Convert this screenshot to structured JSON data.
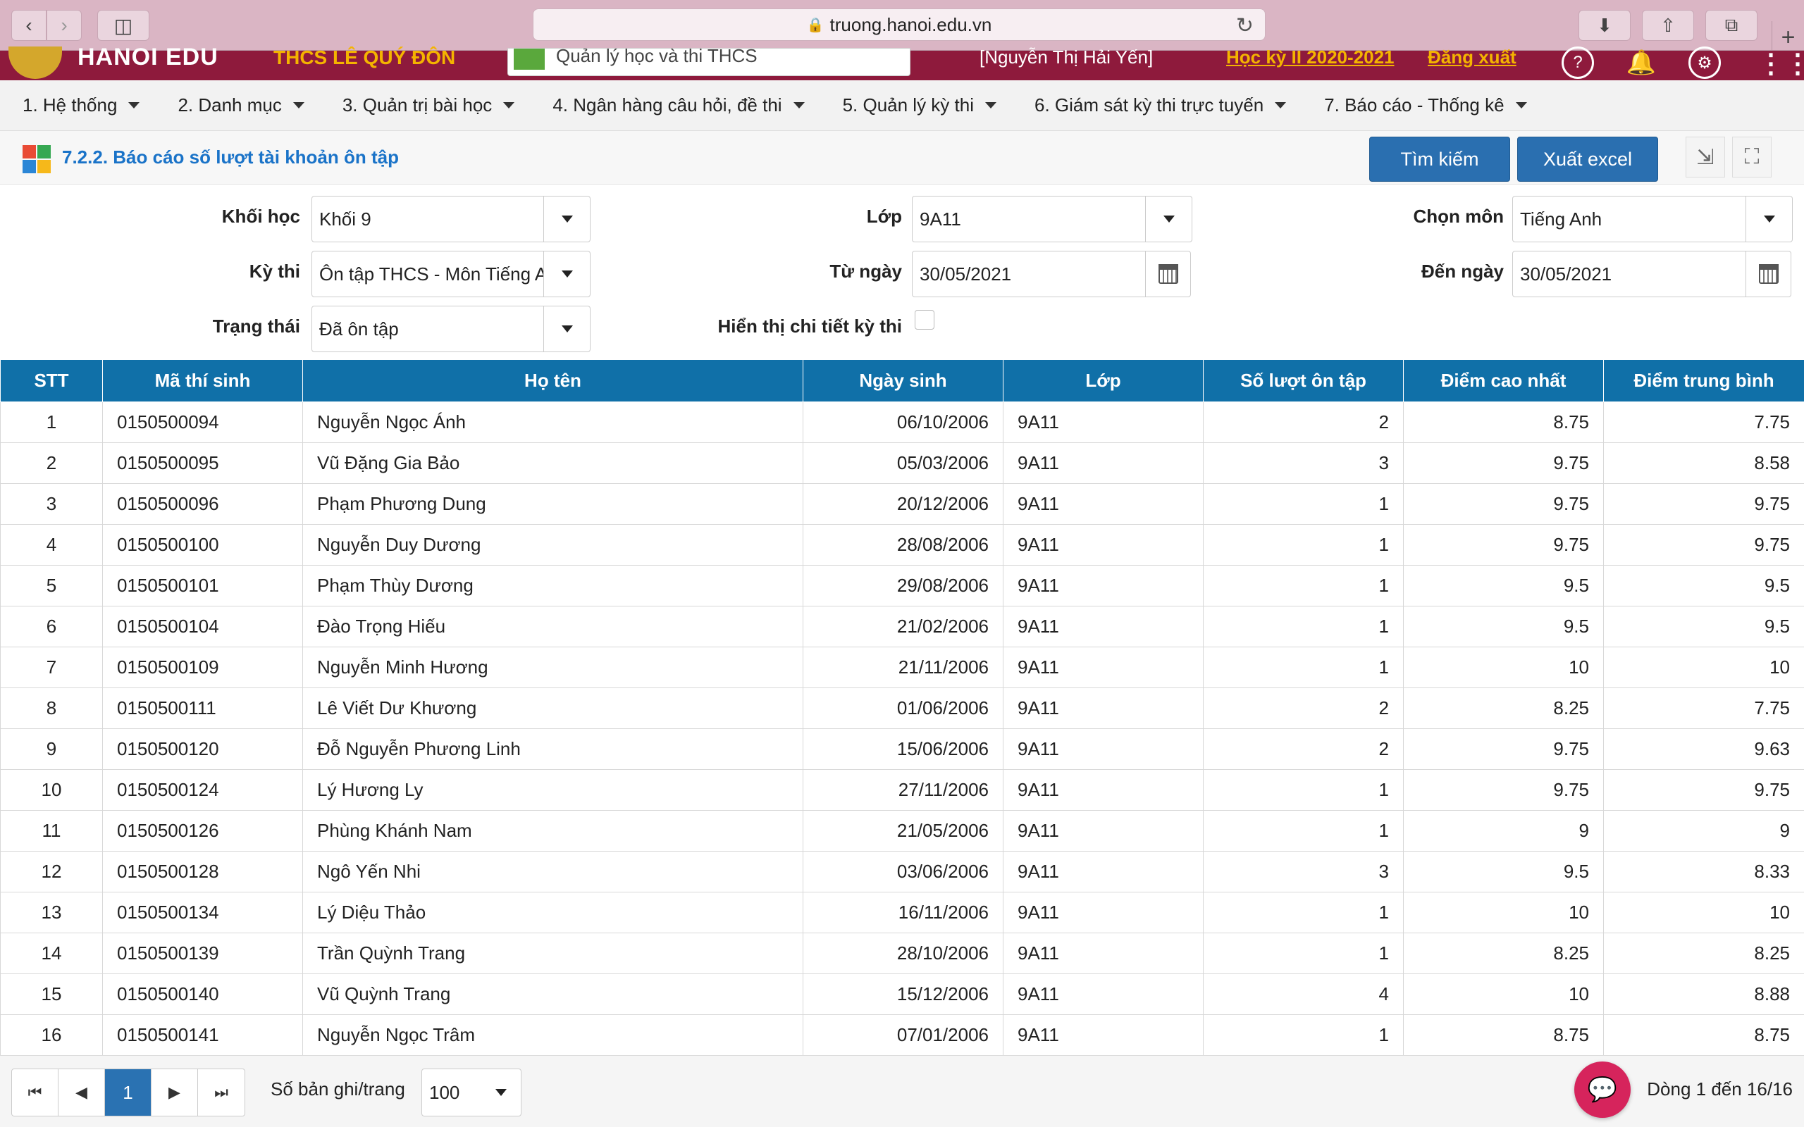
{
  "browser": {
    "url": "truong.hanoi.edu.vn"
  },
  "site": {
    "brand": "HANOI EDU",
    "school": "THCS LÊ QUÝ ĐÔN",
    "module": "Quản lý học và thi THCS",
    "user": "[Nguyễn Thị Hải Yến]",
    "year": "Học kỳ II 2020-2021",
    "logout": "Đăng xuất"
  },
  "menu": [
    "1. Hệ thống",
    "2. Danh mục",
    "3. Quản trị bài học",
    "4. Ngân hàng câu hỏi, đề thi",
    "5. Quản lý kỳ thi",
    "6. Giám sát kỳ thi trực tuyến",
    "7. Báo cáo - Thống kê"
  ],
  "page": {
    "title": "7.2.2. Báo cáo số lượt tài khoản ôn tập",
    "search_label": "Tìm kiếm",
    "excel_label": "Xuất excel",
    "logo_colors": [
      "#e94b35",
      "#36a852",
      "#2b86d6",
      "#f6b81a"
    ]
  },
  "filters": {
    "khoi_label": "Khối học",
    "khoi_value": "Khối 9",
    "lop_label": "Lớp",
    "lop_value": "9A11",
    "mon_label": "Chọn môn",
    "mon_value": "Tiếng Anh",
    "kythi_label": "Kỳ thi",
    "kythi_value": "Ôn tập THCS - Môn Tiếng Anh",
    "tungay_label": "Từ ngày",
    "tungay_value": "30/05/2021",
    "denngay_label": "Đến ngày",
    "denngay_value": "30/05/2021",
    "trangthai_label": "Trạng thái",
    "trangthai_value": "Đã ôn tập",
    "chitiet_label": "Hiển thị chi tiết kỳ thi"
  },
  "table": {
    "headers": [
      "STT",
      "Mã thí sinh",
      "Họ tên",
      "Ngày sinh",
      "Lớp",
      "Số lượt ôn tập",
      "Điểm cao nhất",
      "Điểm trung bình"
    ],
    "rows": [
      [
        "1",
        "0150500094",
        "Nguyễn Ngọc Ánh",
        "06/10/2006",
        "9A11",
        "2",
        "8.75",
        "7.75"
      ],
      [
        "2",
        "0150500095",
        "Vũ Đặng Gia Bảo",
        "05/03/2006",
        "9A11",
        "3",
        "9.75",
        "8.58"
      ],
      [
        "3",
        "0150500096",
        "Phạm Phương Dung",
        "20/12/2006",
        "9A11",
        "1",
        "9.75",
        "9.75"
      ],
      [
        "4",
        "0150500100",
        "Nguyễn Duy Dương",
        "28/08/2006",
        "9A11",
        "1",
        "9.75",
        "9.75"
      ],
      [
        "5",
        "0150500101",
        "Phạm Thùy Dương",
        "29/08/2006",
        "9A11",
        "1",
        "9.5",
        "9.5"
      ],
      [
        "6",
        "0150500104",
        "Đào Trọng Hiếu",
        "21/02/2006",
        "9A11",
        "1",
        "9.5",
        "9.5"
      ],
      [
        "7",
        "0150500109",
        "Nguyễn Minh Hương",
        "21/11/2006",
        "9A11",
        "1",
        "10",
        "10"
      ],
      [
        "8",
        "0150500111",
        "Lê Viết Dư Khương",
        "01/06/2006",
        "9A11",
        "2",
        "8.25",
        "7.75"
      ],
      [
        "9",
        "0150500120",
        "Đỗ Nguyễn Phương Linh",
        "15/06/2006",
        "9A11",
        "2",
        "9.75",
        "9.63"
      ],
      [
        "10",
        "0150500124",
        "Lý Hương Ly",
        "27/11/2006",
        "9A11",
        "1",
        "9.75",
        "9.75"
      ],
      [
        "11",
        "0150500126",
        "Phùng Khánh Nam",
        "21/05/2006",
        "9A11",
        "1",
        "9",
        "9"
      ],
      [
        "12",
        "0150500128",
        "Ngô Yến Nhi",
        "03/06/2006",
        "9A11",
        "3",
        "9.5",
        "8.33"
      ],
      [
        "13",
        "0150500134",
        "Lý Diệu Thảo",
        "16/11/2006",
        "9A11",
        "1",
        "10",
        "10"
      ],
      [
        "14",
        "0150500139",
        "Trần Quỳnh Trang",
        "28/10/2006",
        "9A11",
        "1",
        "8.25",
        "8.25"
      ],
      [
        "15",
        "0150500140",
        "Vũ Quỳnh Trang",
        "15/12/2006",
        "9A11",
        "4",
        "10",
        "8.88"
      ],
      [
        "16",
        "0150500141",
        "Nguyễn Ngọc Trâm",
        "07/01/2006",
        "9A11",
        "1",
        "8.75",
        "8.75"
      ]
    ]
  },
  "pager": {
    "current_page": "1",
    "page_size_label": "Số bản ghi/trang",
    "page_size": "100",
    "row_info": "Dòng 1 đến 16/16"
  }
}
